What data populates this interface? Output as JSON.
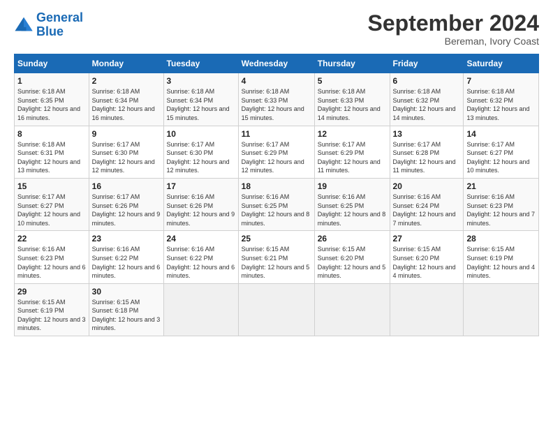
{
  "header": {
    "logo_line1": "General",
    "logo_line2": "Blue",
    "month_title": "September 2024",
    "subtitle": "Bereman, Ivory Coast"
  },
  "days_of_week": [
    "Sunday",
    "Monday",
    "Tuesday",
    "Wednesday",
    "Thursday",
    "Friday",
    "Saturday"
  ],
  "weeks": [
    [
      {
        "day": "1",
        "sunrise": "6:18 AM",
        "sunset": "6:35 PM",
        "daylight": "12 hours and 16 minutes."
      },
      {
        "day": "2",
        "sunrise": "6:18 AM",
        "sunset": "6:34 PM",
        "daylight": "12 hours and 16 minutes."
      },
      {
        "day": "3",
        "sunrise": "6:18 AM",
        "sunset": "6:34 PM",
        "daylight": "12 hours and 15 minutes."
      },
      {
        "day": "4",
        "sunrise": "6:18 AM",
        "sunset": "6:33 PM",
        "daylight": "12 hours and 15 minutes."
      },
      {
        "day": "5",
        "sunrise": "6:18 AM",
        "sunset": "6:33 PM",
        "daylight": "12 hours and 14 minutes."
      },
      {
        "day": "6",
        "sunrise": "6:18 AM",
        "sunset": "6:32 PM",
        "daylight": "12 hours and 14 minutes."
      },
      {
        "day": "7",
        "sunrise": "6:18 AM",
        "sunset": "6:32 PM",
        "daylight": "12 hours and 13 minutes."
      }
    ],
    [
      {
        "day": "8",
        "sunrise": "6:18 AM",
        "sunset": "6:31 PM",
        "daylight": "12 hours and 13 minutes."
      },
      {
        "day": "9",
        "sunrise": "6:17 AM",
        "sunset": "6:30 PM",
        "daylight": "12 hours and 12 minutes."
      },
      {
        "day": "10",
        "sunrise": "6:17 AM",
        "sunset": "6:30 PM",
        "daylight": "12 hours and 12 minutes."
      },
      {
        "day": "11",
        "sunrise": "6:17 AM",
        "sunset": "6:29 PM",
        "daylight": "12 hours and 12 minutes."
      },
      {
        "day": "12",
        "sunrise": "6:17 AM",
        "sunset": "6:29 PM",
        "daylight": "12 hours and 11 minutes."
      },
      {
        "day": "13",
        "sunrise": "6:17 AM",
        "sunset": "6:28 PM",
        "daylight": "12 hours and 11 minutes."
      },
      {
        "day": "14",
        "sunrise": "6:17 AM",
        "sunset": "6:27 PM",
        "daylight": "12 hours and 10 minutes."
      }
    ],
    [
      {
        "day": "15",
        "sunrise": "6:17 AM",
        "sunset": "6:27 PM",
        "daylight": "12 hours and 10 minutes."
      },
      {
        "day": "16",
        "sunrise": "6:17 AM",
        "sunset": "6:26 PM",
        "daylight": "12 hours and 9 minutes."
      },
      {
        "day": "17",
        "sunrise": "6:16 AM",
        "sunset": "6:26 PM",
        "daylight": "12 hours and 9 minutes."
      },
      {
        "day": "18",
        "sunrise": "6:16 AM",
        "sunset": "6:25 PM",
        "daylight": "12 hours and 8 minutes."
      },
      {
        "day": "19",
        "sunrise": "6:16 AM",
        "sunset": "6:25 PM",
        "daylight": "12 hours and 8 minutes."
      },
      {
        "day": "20",
        "sunrise": "6:16 AM",
        "sunset": "6:24 PM",
        "daylight": "12 hours and 7 minutes."
      },
      {
        "day": "21",
        "sunrise": "6:16 AM",
        "sunset": "6:23 PM",
        "daylight": "12 hours and 7 minutes."
      }
    ],
    [
      {
        "day": "22",
        "sunrise": "6:16 AM",
        "sunset": "6:23 PM",
        "daylight": "12 hours and 6 minutes."
      },
      {
        "day": "23",
        "sunrise": "6:16 AM",
        "sunset": "6:22 PM",
        "daylight": "12 hours and 6 minutes."
      },
      {
        "day": "24",
        "sunrise": "6:16 AM",
        "sunset": "6:22 PM",
        "daylight": "12 hours and 6 minutes."
      },
      {
        "day": "25",
        "sunrise": "6:15 AM",
        "sunset": "6:21 PM",
        "daylight": "12 hours and 5 minutes."
      },
      {
        "day": "26",
        "sunrise": "6:15 AM",
        "sunset": "6:20 PM",
        "daylight": "12 hours and 5 minutes."
      },
      {
        "day": "27",
        "sunrise": "6:15 AM",
        "sunset": "6:20 PM",
        "daylight": "12 hours and 4 minutes."
      },
      {
        "day": "28",
        "sunrise": "6:15 AM",
        "sunset": "6:19 PM",
        "daylight": "12 hours and 4 minutes."
      }
    ],
    [
      {
        "day": "29",
        "sunrise": "6:15 AM",
        "sunset": "6:19 PM",
        "daylight": "12 hours and 3 minutes."
      },
      {
        "day": "30",
        "sunrise": "6:15 AM",
        "sunset": "6:18 PM",
        "daylight": "12 hours and 3 minutes."
      },
      null,
      null,
      null,
      null,
      null
    ]
  ],
  "labels": {
    "sunrise": "Sunrise:",
    "sunset": "Sunset:",
    "daylight": "Daylight:"
  }
}
